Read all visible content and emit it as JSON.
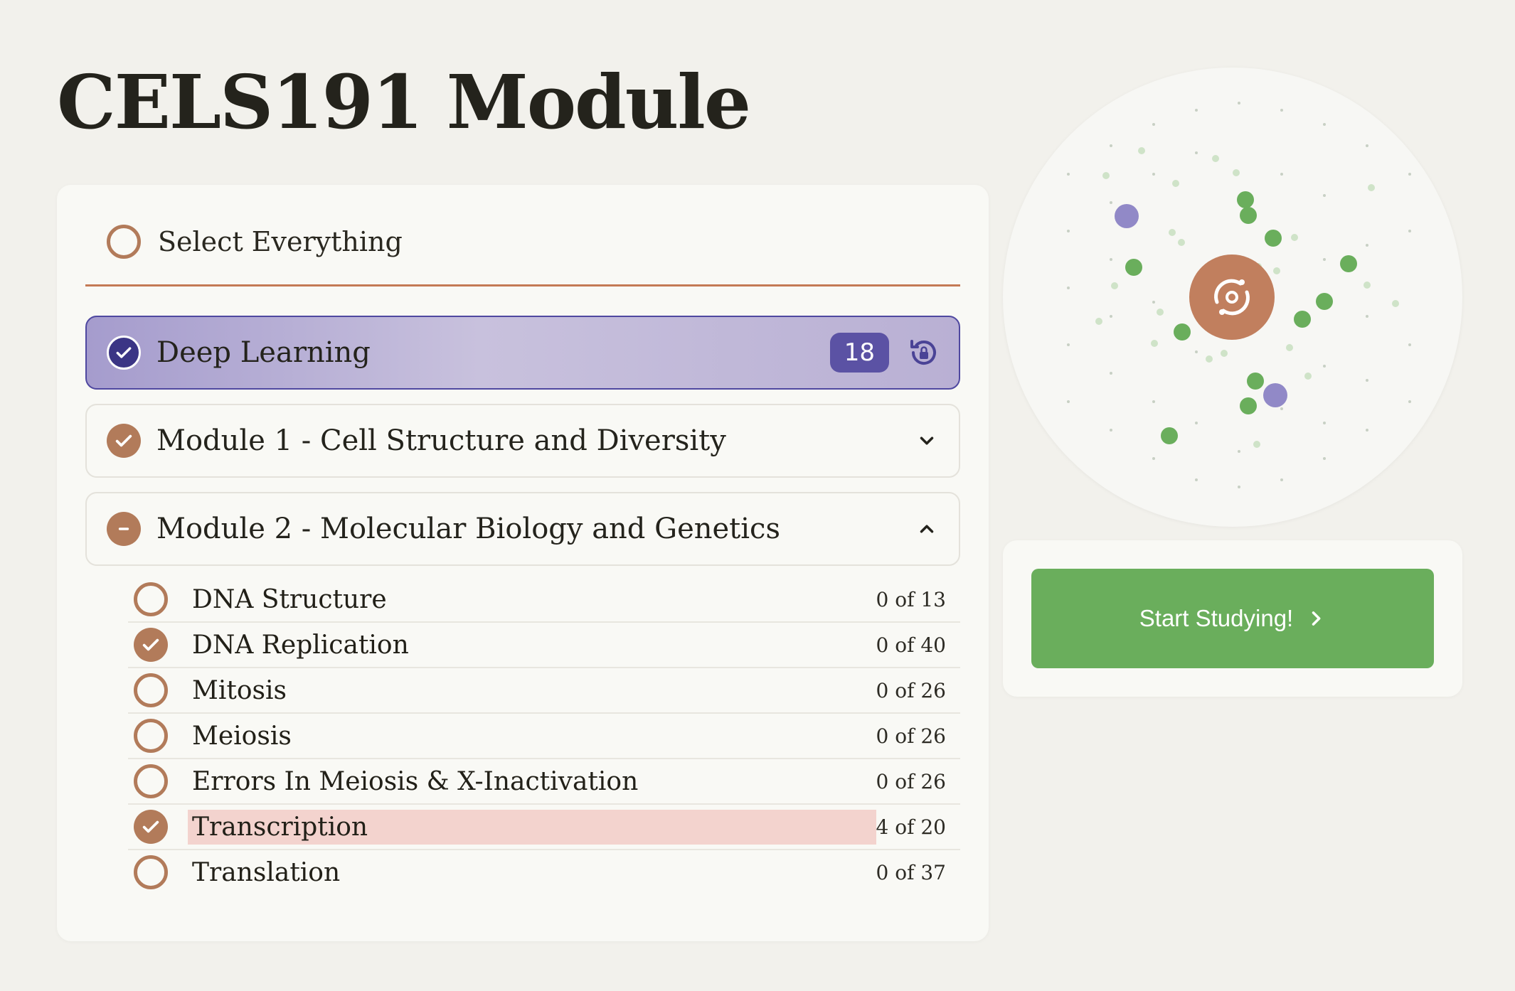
{
  "page": {
    "title": "CELS191 Module"
  },
  "select_all": {
    "label": "Select Everything"
  },
  "deep_learning": {
    "label": "Deep Learning",
    "count": "18"
  },
  "modules": [
    {
      "label": "Module 1 - Cell Structure and Diversity",
      "state": "checked",
      "expanded": false
    },
    {
      "label": "Module 2 - Molecular Biology and Genetics",
      "state": "partial",
      "expanded": true
    }
  ],
  "topics": [
    {
      "name": "DNA Structure",
      "progress": "0 of 13",
      "checked": false
    },
    {
      "name": "DNA Replication",
      "progress": "0 of 40",
      "checked": true
    },
    {
      "name": "Mitosis",
      "progress": "0 of 26",
      "checked": false
    },
    {
      "name": "Meiosis",
      "progress": "0 of 26",
      "checked": false
    },
    {
      "name": "Errors In Meiosis & X-Inactivation",
      "progress": "0 of 26",
      "checked": false
    },
    {
      "name": "Transcription",
      "progress": "4 of 20",
      "checked": true,
      "highlighted": true
    },
    {
      "name": "Translation",
      "progress": "0 of 37",
      "checked": false
    }
  ],
  "start_button": {
    "label": "Start Studying!"
  },
  "colors": {
    "accent_brown": "#b27b5a",
    "purple": "#5b52a4",
    "green": "#6aae5c",
    "highlight": "#f3d3ce"
  },
  "icons": {
    "check": "check-icon",
    "reset": "reset-lock-icon",
    "chevron_down": "chevron-down-icon",
    "chevron_up": "chevron-up-icon",
    "hub": "sync-hub-icon",
    "arrow": "chevron-right-icon"
  }
}
